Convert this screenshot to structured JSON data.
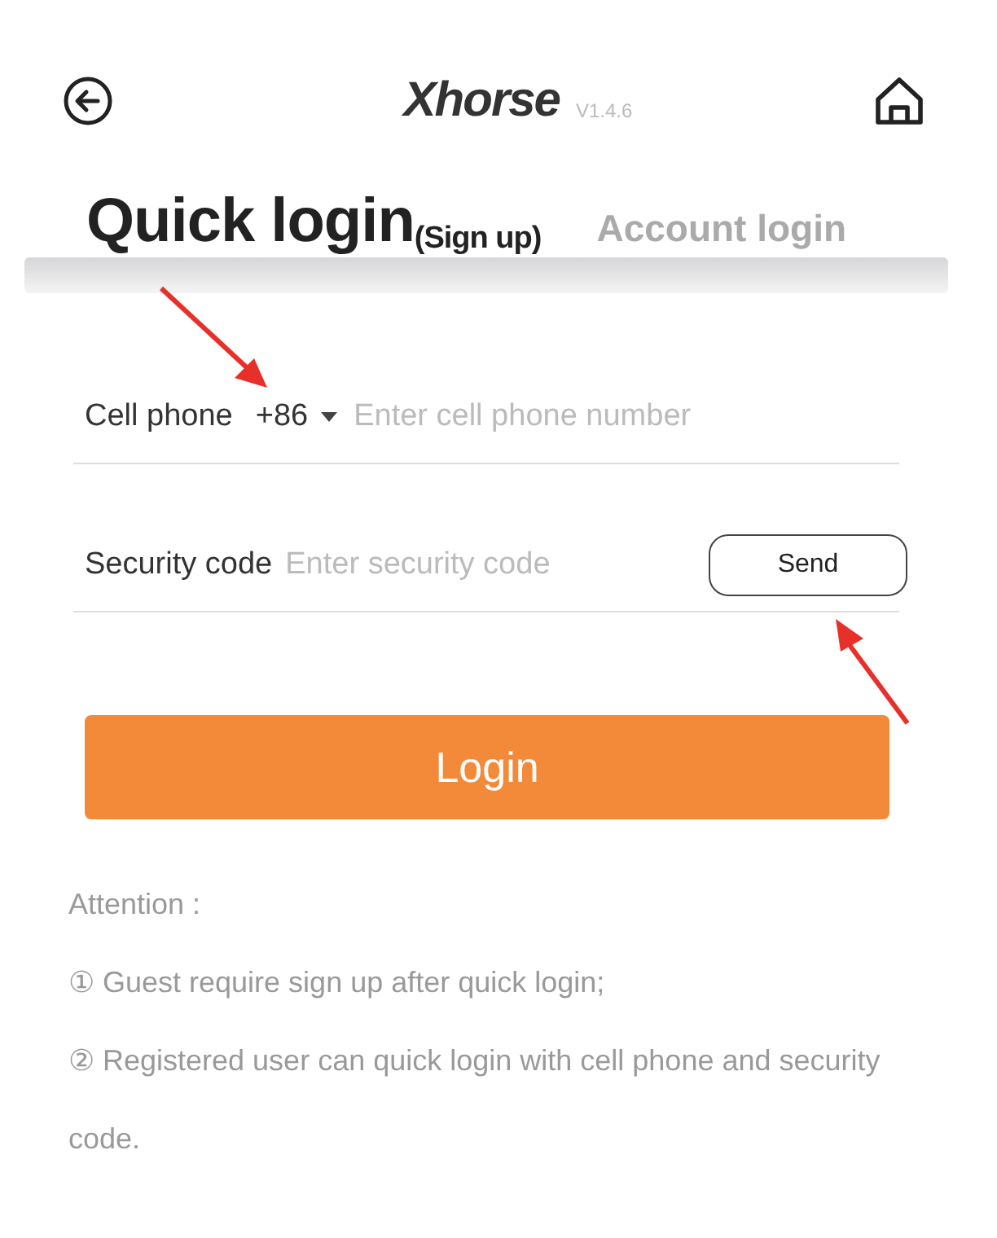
{
  "header": {
    "logo": "Xhorse",
    "version": "V1.4.6"
  },
  "tabs": [
    {
      "label": "Quick login",
      "note": "(Sign up)",
      "selected": true
    },
    {
      "label": "Account login",
      "selected": false
    }
  ],
  "phone": {
    "label": "Cell phone",
    "country_code": "+86",
    "placeholder": "Enter cell phone number"
  },
  "security": {
    "label": "Security code",
    "placeholder": "Enter security code",
    "button": "Send"
  },
  "login_button": "Login",
  "notes": {
    "title": "Attention :",
    "items": [
      "① Guest require sign up after quick login;",
      "② Registered user can quick login with cell phone and security code."
    ]
  }
}
